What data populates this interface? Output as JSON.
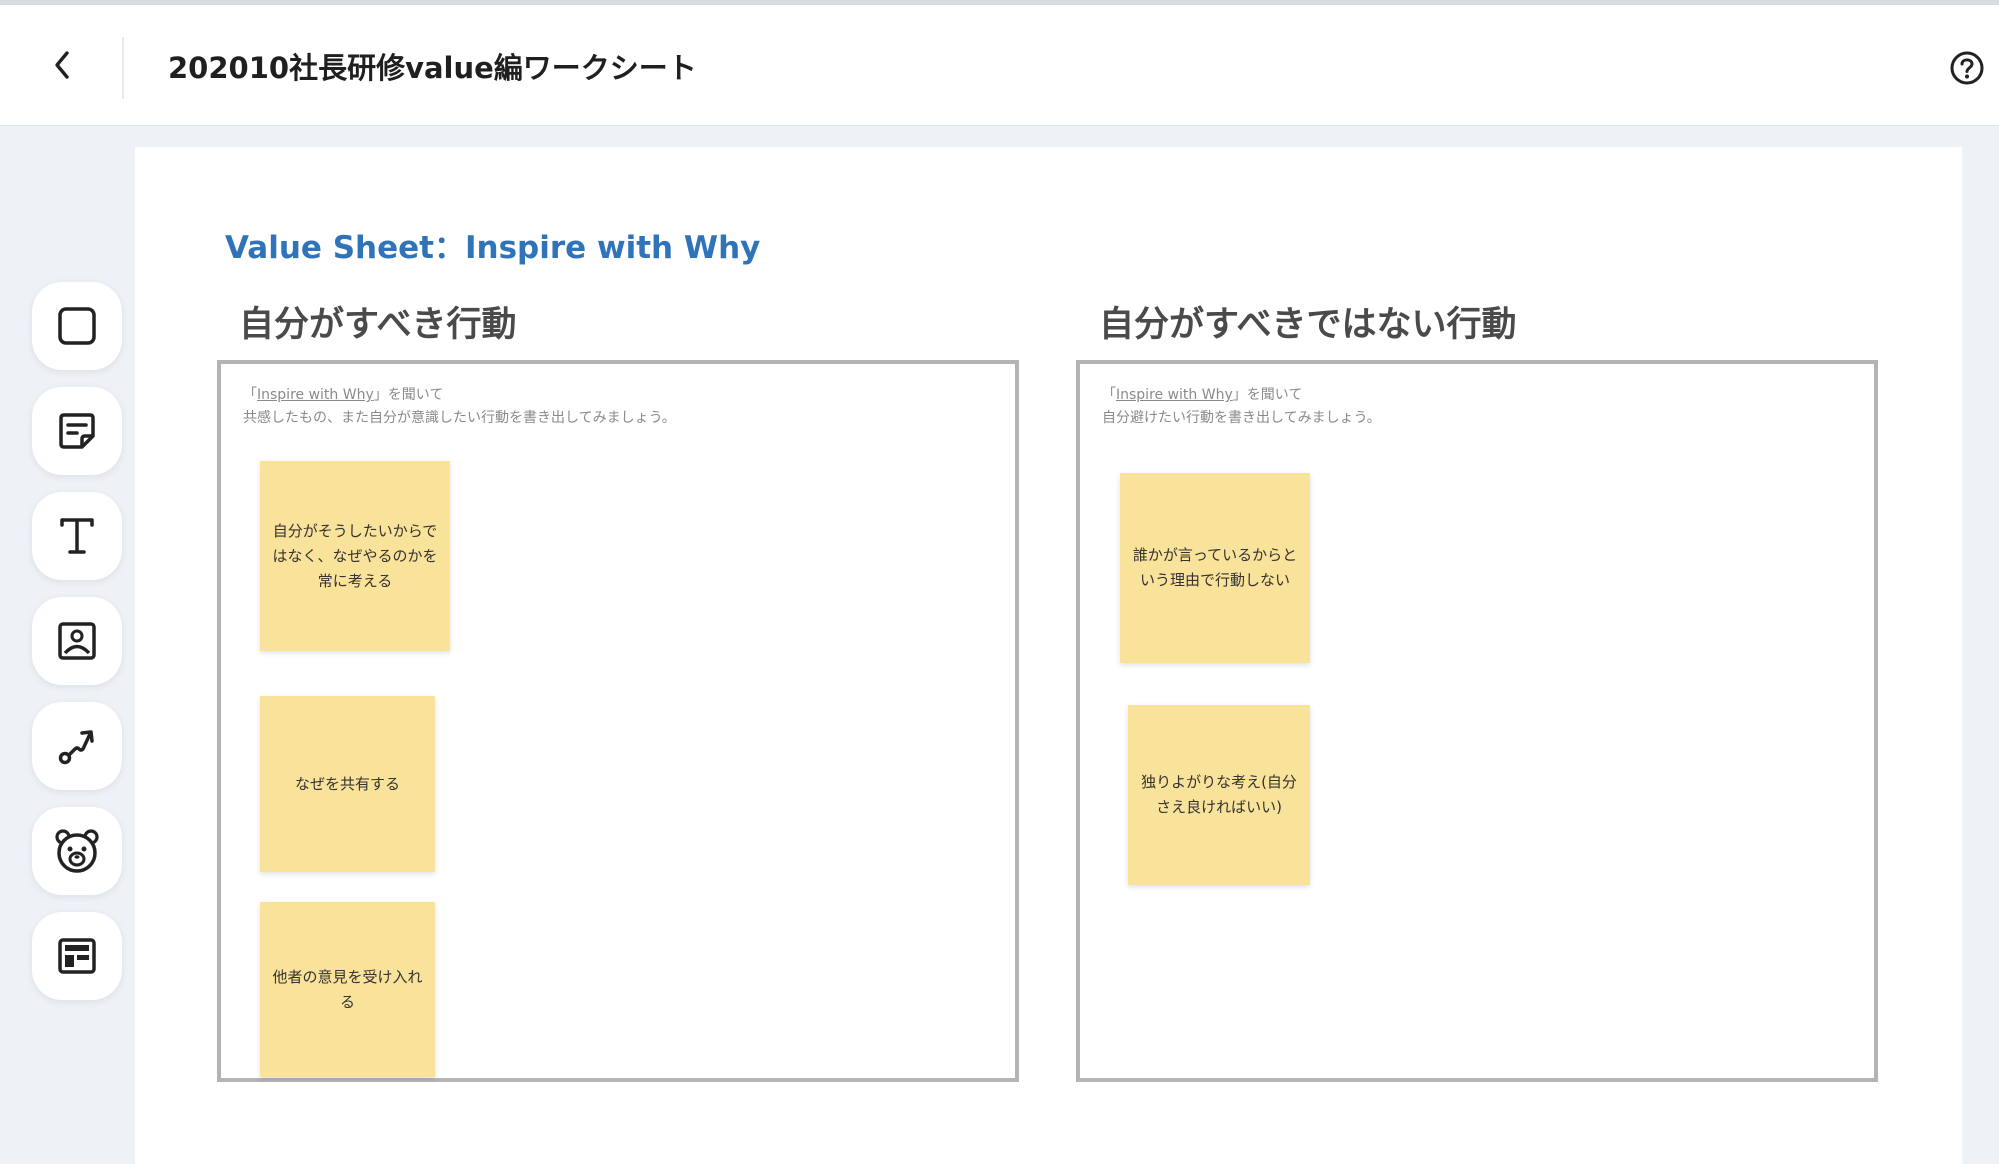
{
  "header": {
    "title": "202010社長研修value編ワークシート",
    "back_icon": "chevron-left-icon",
    "help_icon": "question-circle-icon"
  },
  "toolbar": {
    "tools": [
      {
        "name": "shape",
        "icon": "square-icon"
      },
      {
        "name": "sticky-note",
        "icon": "sticky-note-icon"
      },
      {
        "name": "text",
        "icon": "text-icon"
      },
      {
        "name": "image",
        "icon": "image-icon"
      },
      {
        "name": "connector",
        "icon": "connector-icon"
      },
      {
        "name": "bear",
        "icon": "bear-icon"
      },
      {
        "name": "template",
        "icon": "template-icon"
      }
    ]
  },
  "sheet": {
    "title": "Value Sheet：Inspire with Why",
    "left": {
      "heading": "自分がすべき行動",
      "instruction_prefix": "「",
      "instruction_link": "Inspire with Why",
      "instruction_suffix": "」を聞いて",
      "instruction_line2": "共感したもの、また自分が意識したい行動を書き出してみましょう。",
      "notes": [
        "自分がそうしたいからではなく、なぜやるのかを常に考える",
        "なぜを共有する",
        "他者の意見を受け入れる"
      ]
    },
    "right": {
      "heading": "自分がすべきではない行動",
      "instruction_prefix": "「",
      "instruction_link": "Inspire with Why",
      "instruction_suffix": "」を聞いて",
      "instruction_line2": "自分避けたい行動を書き出してみましょう。",
      "notes": [
        "誰かが言っているからという理由で行動しない",
        "独りよがりな考え(自分さえ良ければいい)"
      ]
    }
  },
  "colors": {
    "sticky": "#f9e29a",
    "sheet_title": "#2f73b8",
    "frame_border": "#b4b4b4",
    "background": "#eef2f7"
  }
}
